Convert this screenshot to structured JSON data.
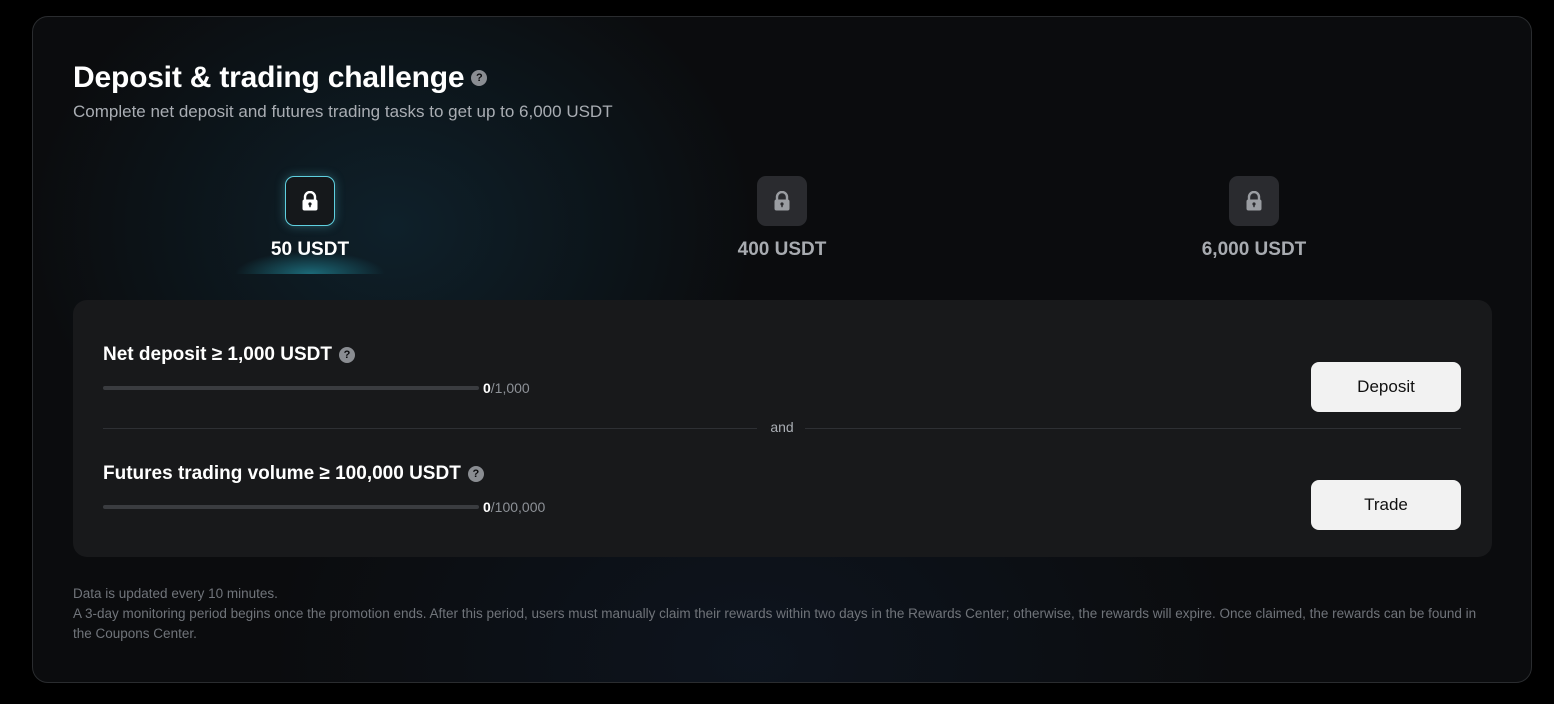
{
  "header": {
    "title": "Deposit & trading challenge",
    "help_glyph": "?",
    "subtitle": "Complete net deposit and futures trading tasks to get up to 6,000 USDT"
  },
  "tiers": [
    {
      "amount": "50 USDT",
      "active": true,
      "icon": "lock-icon"
    },
    {
      "amount": "400 USDT",
      "active": false,
      "icon": "lock-icon"
    },
    {
      "amount": "6,000 USDT",
      "active": false,
      "icon": "lock-icon"
    }
  ],
  "tasks": {
    "deposit": {
      "title": "Net deposit ≥ 1,000 USDT",
      "progress_current": "0",
      "progress_total": "/1,000",
      "progress_fraction": 0,
      "button_label": "Deposit"
    },
    "connector": "and",
    "trading": {
      "title": "Futures trading volume ≥ 100,000 USDT",
      "progress_current": "0",
      "progress_total": "/100,000",
      "progress_fraction": 0,
      "button_label": "Trade"
    }
  },
  "notes": {
    "line1": "Data is updated every 10 minutes.",
    "line2": "A 3-day monitoring period begins once the promotion ends. After this period, users must manually claim their rewards within two days in the Rewards Center; otherwise, the rewards will expire. Once claimed, the rewards can be found in the Coupons Center."
  },
  "colors": {
    "accent": "#5fd0e0",
    "background": "#0b0c0e",
    "panel": "#18191b",
    "button": "#f2f2f2"
  }
}
